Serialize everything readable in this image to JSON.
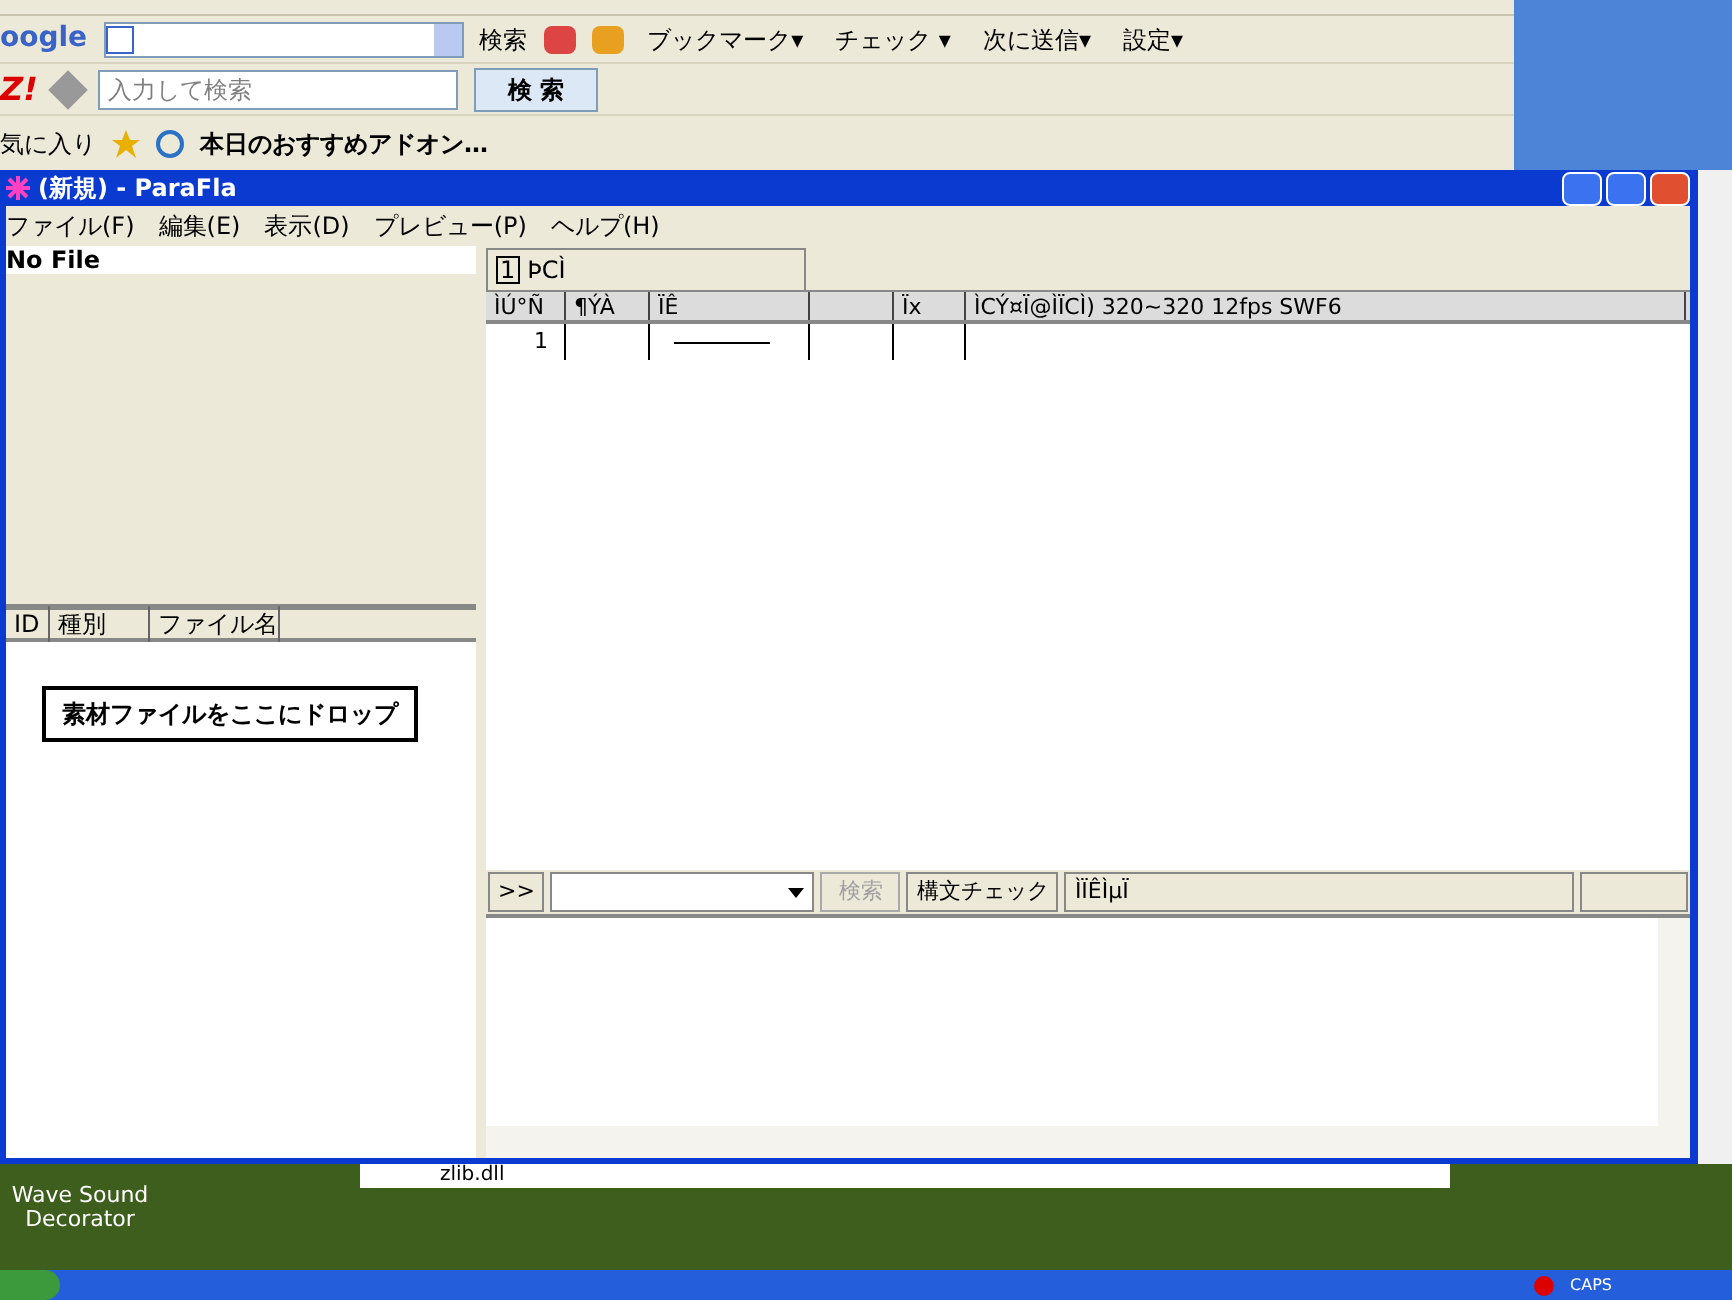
{
  "browser_toolbar": {
    "logo": "oogle",
    "search_button": "検索",
    "items": [
      {
        "label": "ブックマーク▾"
      },
      {
        "label": "チェック ▾"
      },
      {
        "label": "次に送信▾"
      },
      {
        "label": "設定▾"
      }
    ]
  },
  "yahoo_toolbar": {
    "logo": "Z!",
    "placeholder": "入力して検索",
    "search_button": "検 索"
  },
  "favorites_bar": {
    "label": "気に入り",
    "item": "本日のおすすめアドオン…"
  },
  "window": {
    "title": "(新規) - ParaFla",
    "menu": [
      "ファイル(F)",
      "編集(E)",
      "表示(D)",
      "プレビュー(P)",
      "ヘルプ(H)"
    ]
  },
  "file_pane": {
    "header": "No File",
    "columns": [
      "ID",
      "種別",
      "ファイル名"
    ],
    "drop_button": "素材ファイルをここにドロップ"
  },
  "timeline": {
    "tabs": [
      {
        "number": "1",
        "label": "ÞCÌ",
        "selected": true
      }
    ],
    "columns": [
      "ÌÚ°Ñ",
      "¶ÝÀ",
      "ÏÊ",
      "",
      "Ïx",
      "ÌCÝ¤Ï@ÌÏCÌ) 320~320 12fps SWF6"
    ],
    "rows": [
      {
        "cells": [
          "1",
          "",
          "",
          "",
          "",
          ""
        ]
      }
    ]
  },
  "script_bar": {
    "expand_button": ">>",
    "search_button": {
      "label": "検索",
      "disabled": true
    },
    "syntax_check_button": "構文チェック",
    "status": "ÌÏÊÌµÏ"
  },
  "desktop": {
    "icon_label": "Wave Sound Decorator",
    "background_window_text": "zlib.dll"
  },
  "tray": {
    "caps": "CAPS"
  }
}
